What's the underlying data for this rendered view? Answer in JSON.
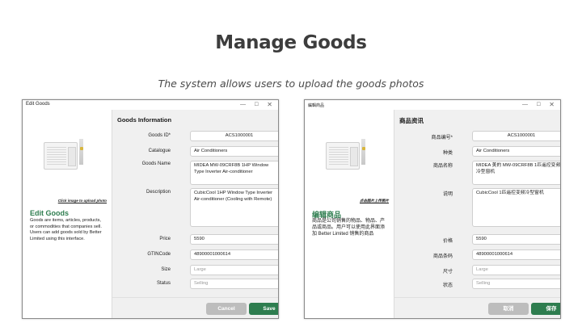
{
  "slide": {
    "title": "Manage Goods",
    "subtitle": "The system allows users to upload the goods photos"
  },
  "colors": {
    "accent": "#2e7d4f",
    "cancel": "#bdbdbd",
    "pane": "#f0f0f0"
  },
  "icons": {
    "minimize": "minimize-icon",
    "maximize": "maximize-icon",
    "close": "close-icon",
    "dropdown": "chevron-down-icon"
  },
  "en": {
    "window_title": "Edit Goods",
    "upload_link": "Click image to upload photo",
    "heading": "Edit Goods",
    "description": "Goods are items, articles, products, or commodities that companies sell. Users can add goods sold by Better Limited using this interface.",
    "section_title": "Goods Information",
    "fields": {
      "goods_id": {
        "label": "Goods ID*",
        "value": "ACS1000001"
      },
      "catalogue": {
        "label": "Catalogue",
        "value": "Air Conditioners"
      },
      "goods_name": {
        "label": "Goods Name",
        "value": "MIDEA MW-09CRF8B 1HP Window Type Inverter Air-conditioner"
      },
      "description": {
        "label": "Description",
        "value": "CubicCool 1HP Window Type Inverter Air-conditioner (Cooling with Remote)"
      },
      "price": {
        "label": "Price",
        "value": "5590"
      },
      "gtin": {
        "label": "GTINCode",
        "value": "48900001000614"
      },
      "size": {
        "label": "Size",
        "value": "Large"
      },
      "status": {
        "label": "Status",
        "value": "Selling"
      }
    },
    "cancel_label": "Cancel",
    "save_label": "Save"
  },
  "zh": {
    "window_title": "編輯商品",
    "upload_link": "点击图片上传照片",
    "heading": "编辑商品",
    "description": "商品是公司销售的物品、物品、产品或商品。用户可以使用此界面添加 Better Limited 销售的商品",
    "section_title": "商品资讯",
    "fields": {
      "goods_id": {
        "label": "商品编号*",
        "value": "ACS1000001"
      },
      "catalogue": {
        "label": "种类",
        "value": "Air Conditioners"
      },
      "goods_name": {
        "label": "商品名称",
        "value": "MIDEA 美的 MW-09CRF8B 1匹遥控变频冷型窗机"
      },
      "description": {
        "label": "说明",
        "value": "CubicCool 1匹遥控变频冷型窗机"
      },
      "price": {
        "label": "价格",
        "value": "5590"
      },
      "gtin": {
        "label": "商品条码",
        "value": "48900001000614"
      },
      "size": {
        "label": "尺寸",
        "value": "Large"
      },
      "status": {
        "label": "状态",
        "value": "Selling"
      }
    },
    "cancel_label": "取消",
    "save_label": "保存"
  }
}
